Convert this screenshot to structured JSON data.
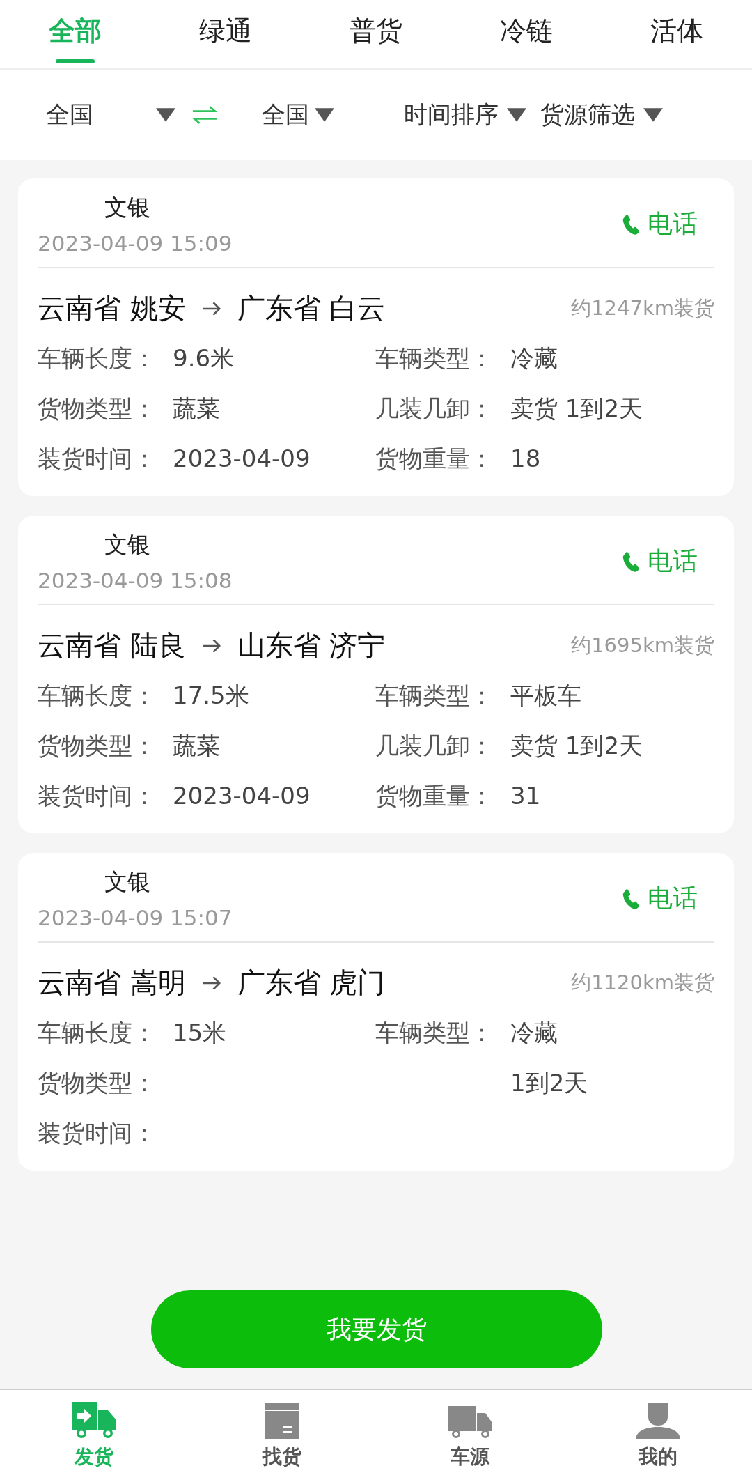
{
  "tabs": [
    {
      "label": "全部",
      "selected": true
    },
    {
      "label": "绿通",
      "selected": false
    },
    {
      "label": "普货",
      "selected": false
    },
    {
      "label": "冷链",
      "selected": false
    },
    {
      "label": "活体",
      "selected": false
    }
  ],
  "filters": {
    "from": "全国",
    "to": "全国",
    "sort": "时间排序",
    "filter": "货源筛选"
  },
  "cards": [
    {
      "name": "文银",
      "time": "2023-04-09 15:09",
      "call": "电话",
      "origin": "云南省 姚安",
      "destination": "广东省 白云",
      "distance": "约1247km装货",
      "fields": [
        {
          "label": "车辆长度：",
          "value": "9.6米"
        },
        {
          "label": "车辆类型：",
          "value": "冷藏"
        },
        {
          "label": "货物类型：",
          "value": "蔬菜"
        },
        {
          "label": "几装几卸：",
          "value": "卖货 1到2天"
        },
        {
          "label": "装货时间：",
          "value": "2023-04-09"
        },
        {
          "label": "货物重量：",
          "value": "18"
        }
      ]
    },
    {
      "name": "文银",
      "time": "2023-04-09 15:08",
      "call": "电话",
      "origin": "云南省 陆良",
      "destination": "山东省 济宁",
      "distance": "约1695km装货",
      "fields": [
        {
          "label": "车辆长度：",
          "value": "17.5米"
        },
        {
          "label": "车辆类型：",
          "value": "平板车"
        },
        {
          "label": "货物类型：",
          "value": "蔬菜"
        },
        {
          "label": "几装几卸：",
          "value": "卖货 1到2天"
        },
        {
          "label": "装货时间：",
          "value": "2023-04-09"
        },
        {
          "label": "货物重量：",
          "value": "31"
        }
      ]
    },
    {
      "name": "文银",
      "time": "2023-04-09 15:07",
      "call": "电话",
      "origin": "云南省 嵩明",
      "destination": "广东省 虎门",
      "distance": "约1120km装货",
      "fields": [
        {
          "label": "车辆长度：",
          "value": "15米"
        },
        {
          "label": "车辆类型：",
          "value": "冷藏"
        },
        {
          "label": "货物类型："
        },
        {
          "value": "1到2天"
        },
        {
          "label": "装货时间："
        }
      ]
    }
  ],
  "ship_button": "我要发货",
  "nav": [
    {
      "label": "发货",
      "kind": "ship",
      "selected": true
    },
    {
      "label": "找货",
      "kind": "box",
      "selected": false
    },
    {
      "label": "车源",
      "kind": "truck",
      "selected": false
    },
    {
      "label": "我的",
      "kind": "user",
      "selected": false
    }
  ]
}
